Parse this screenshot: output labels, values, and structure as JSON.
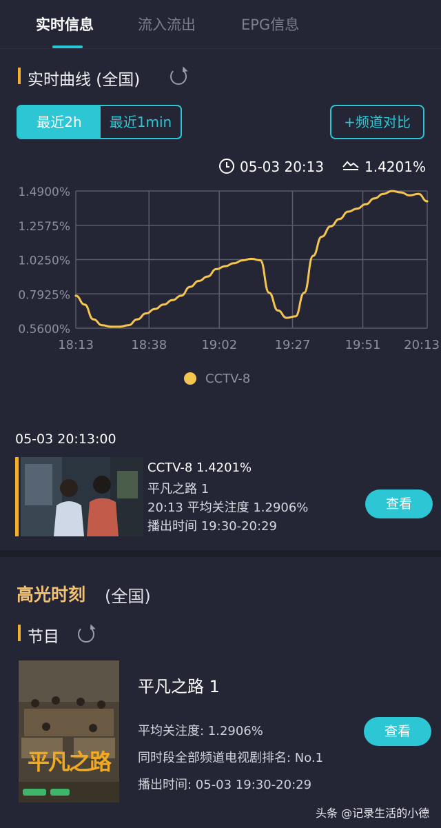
{
  "tabs": [
    {
      "label": "实时信息",
      "active": true
    },
    {
      "label": "流入流出",
      "active": false
    },
    {
      "label": "EPG信息",
      "active": false
    }
  ],
  "realtime": {
    "title": "实时曲线 (全国)",
    "range_options": [
      "最近2h",
      "最近1min"
    ],
    "selected_range": "最近2h",
    "compare_label": "+频道对比",
    "time_readout": "05-03 20:13",
    "value_readout": "1.4201%"
  },
  "chart_data": {
    "type": "line",
    "title": "",
    "xlabel": "",
    "ylabel": "",
    "x_ticks": [
      "18:13",
      "18:38",
      "19:02",
      "19:27",
      "19:51",
      "20:13"
    ],
    "y_ticks": [
      "1.4900%",
      "1.2575%",
      "1.0250%",
      "0.7925%",
      "0.5600%"
    ],
    "ylim": [
      0.56,
      1.49
    ],
    "grid": true,
    "legend_position": "bottom",
    "series": [
      {
        "name": "CCTV-8",
        "color": "#f4c551",
        "x": [
          "18:13",
          "18:16",
          "18:19",
          "18:22",
          "18:25",
          "18:28",
          "18:31",
          "18:34",
          "18:37",
          "18:40",
          "18:43",
          "18:46",
          "18:49",
          "18:52",
          "18:55",
          "18:58",
          "19:01",
          "19:04",
          "19:07",
          "19:10",
          "19:13",
          "19:16",
          "19:19",
          "19:22",
          "19:25",
          "19:28",
          "19:31",
          "19:34",
          "19:37",
          "19:40",
          "19:43",
          "19:46",
          "19:49",
          "19:52",
          "19:55",
          "19:58",
          "20:01",
          "20:04",
          "20:07",
          "20:10",
          "20:13"
        ],
        "values": [
          0.78,
          0.72,
          0.62,
          0.58,
          0.57,
          0.57,
          0.58,
          0.62,
          0.66,
          0.69,
          0.72,
          0.75,
          0.78,
          0.84,
          0.88,
          0.91,
          0.96,
          0.98,
          1.0,
          1.02,
          1.03,
          1.02,
          0.8,
          0.68,
          0.63,
          0.64,
          0.8,
          1.05,
          1.18,
          1.25,
          1.3,
          1.35,
          1.37,
          1.4,
          1.44,
          1.47,
          1.49,
          1.48,
          1.46,
          1.47,
          1.42
        ]
      }
    ]
  },
  "now_card": {
    "timestamp": "05-03 20:13:00",
    "line1": "CCTV-8 1.4201%",
    "line2": "平凡之路 1",
    "line3": "20:13 平均关注度 1.2906%",
    "line4": "播出时间 19:30-20:29",
    "view_label": "查看"
  },
  "highlights": {
    "title": "高光时刻",
    "scope": "(全国)",
    "sub_title": "节目",
    "program": {
      "name": "平凡之路 1",
      "avg_attention": "平均关注度:  1.2906%",
      "ranking": "同时段全部频道电视剧排名:  No.1",
      "airtime": "播出时间:  05-03 19:30-20:29",
      "view_label": "查看",
      "poster_text": "平凡之路"
    }
  },
  "watermark": "头条 @记录生活的小德",
  "colors": {
    "accent": "#2cc6d5",
    "mark": "#f2b02c",
    "line": "#f4c551",
    "background": "#242635"
  }
}
